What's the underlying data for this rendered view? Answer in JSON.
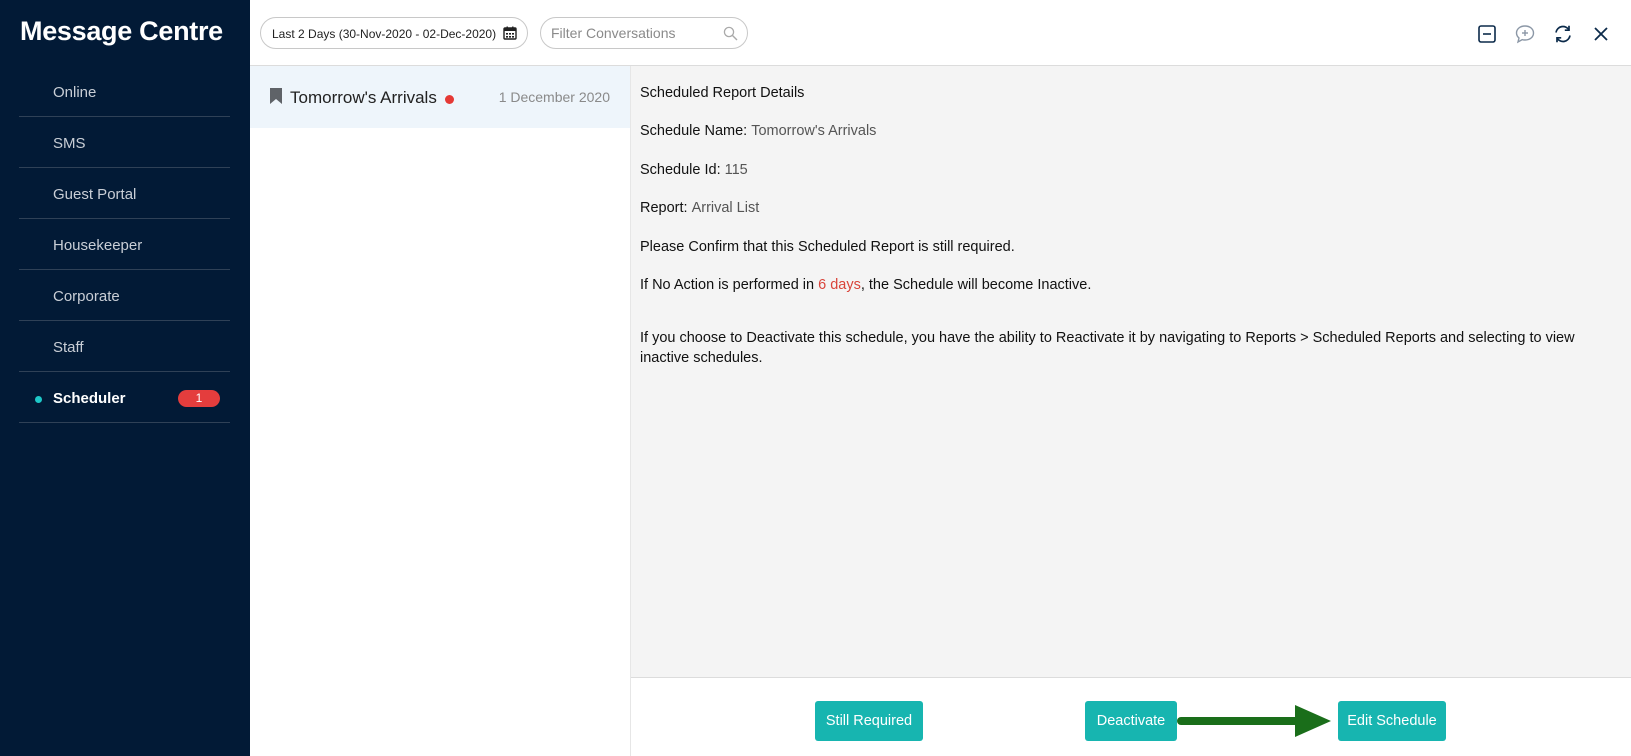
{
  "sidebar": {
    "title": "Message Centre",
    "items": [
      {
        "label": "Online"
      },
      {
        "label": "SMS"
      },
      {
        "label": "Guest Portal"
      },
      {
        "label": "Housekeeper"
      },
      {
        "label": "Corporate"
      },
      {
        "label": "Staff"
      },
      {
        "label": "Scheduler",
        "active": true,
        "badge": "1"
      }
    ]
  },
  "toolbar": {
    "date_range": "Last 2 Days (30-Nov-2020 - 02-Dec-2020)",
    "filter_placeholder": "Filter Conversations",
    "icons": [
      "collapse-icon",
      "new-message-icon",
      "refresh-icon",
      "close-icon"
    ]
  },
  "conversations": [
    {
      "title": "Tomorrow's Arrivals",
      "date": "1 December 2020",
      "unread": true,
      "icon": "bookmark-icon"
    }
  ],
  "detail": {
    "heading": "Scheduled Report Details",
    "schedule_name_label": "Schedule Name:",
    "schedule_name": "Tomorrow's Arrivals",
    "schedule_id_label": "Schedule Id:",
    "schedule_id": "115",
    "report_label": "Report:",
    "report": "Arrival List",
    "confirm_text": "Please Confirm that this Scheduled Report is still required.",
    "no_action_prefix": "If No Action is performed in ",
    "no_action_days": "6 days",
    "no_action_suffix": ", the Schedule will become Inactive.",
    "deactivate_info": "If you choose to Deactivate this schedule, you have the ability to Reactivate it by navigating to Reports > Scheduled Reports and selecting to view inactive schedules."
  },
  "actions": {
    "still_required": "Still Required",
    "deactivate": "Deactivate",
    "edit_schedule": "Edit Schedule"
  },
  "colors": {
    "sidebar_bg": "#021a36",
    "accent_teal": "#17b5b0",
    "badge_red": "#e43d3d",
    "warning_red": "#d9443a",
    "annotation_arrow": "#1a6e1a"
  }
}
